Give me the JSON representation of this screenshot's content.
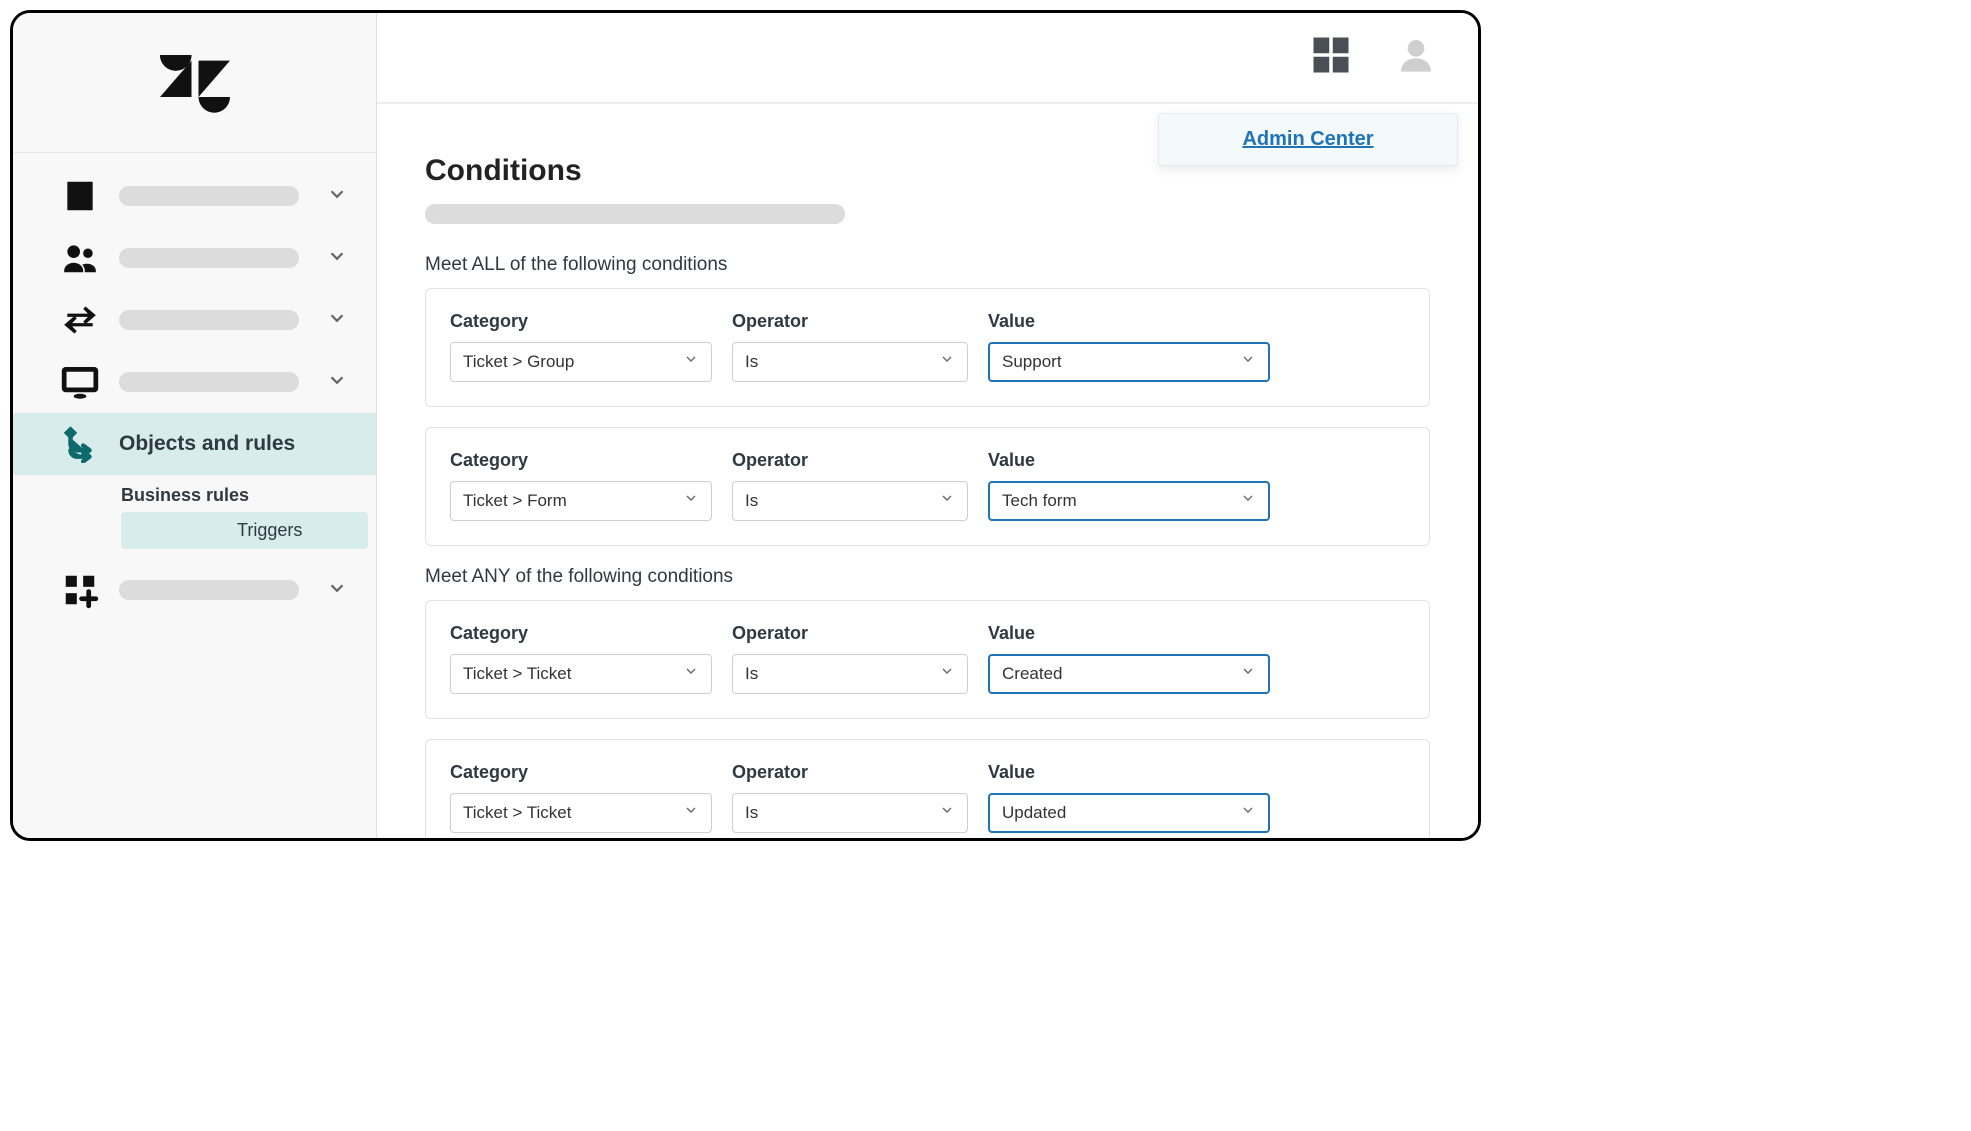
{
  "header": {
    "admin_link": "Admin Center"
  },
  "sidebar": {
    "active_label": "Objects and rules",
    "submenu": {
      "heading": "Business rules",
      "active_item": "Triggers"
    }
  },
  "page": {
    "title": "Conditions",
    "all_label": "Meet ALL of the following conditions",
    "any_label": "Meet ANY of the following conditions",
    "labels": {
      "category": "Category",
      "operator": "Operator",
      "value": "Value"
    },
    "all_conditions": [
      {
        "category": "Ticket > Group",
        "operator": "Is",
        "value": "Support"
      },
      {
        "category": "Ticket > Form",
        "operator": "Is",
        "value": "Tech form"
      }
    ],
    "any_conditions": [
      {
        "category": "Ticket > Ticket",
        "operator": "Is",
        "value": "Created"
      },
      {
        "category": "Ticket > Ticket",
        "operator": "Is",
        "value": "Updated"
      }
    ]
  }
}
